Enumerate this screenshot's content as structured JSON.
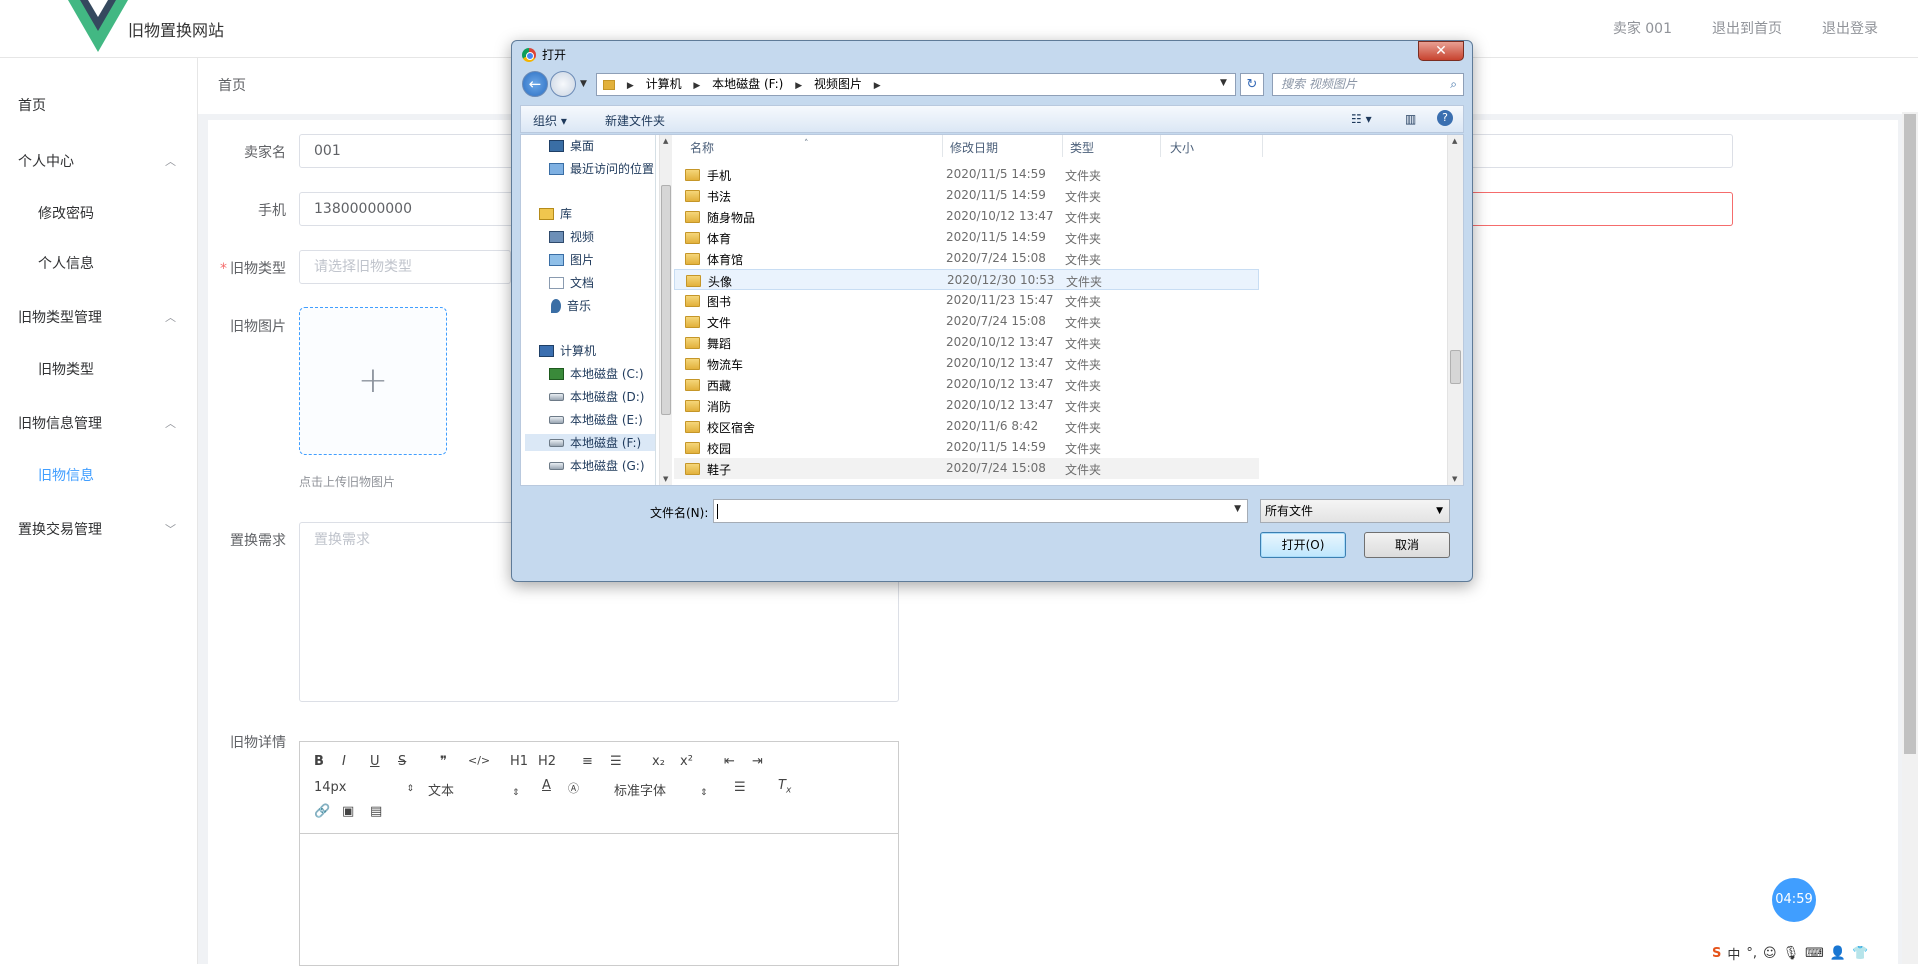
{
  "site": {
    "title": "旧物置换网站",
    "brand_color": "#42b883"
  },
  "top_links": [
    "卖家 001",
    "退出到首页",
    "退出登录"
  ],
  "sidebar": {
    "items": [
      {
        "label": "首页",
        "level": 1,
        "arrow": ""
      },
      {
        "label": "个人中心",
        "level": 1,
        "arrow": "^"
      },
      {
        "label": "修改密码",
        "level": 2,
        "arrow": ""
      },
      {
        "label": "个人信息",
        "level": 2,
        "arrow": ""
      },
      {
        "label": "旧物类型管理",
        "level": 1,
        "arrow": "^"
      },
      {
        "label": "旧物类型",
        "level": 2,
        "arrow": ""
      },
      {
        "label": "旧物信息管理",
        "level": 1,
        "arrow": "^"
      },
      {
        "label": "旧物信息",
        "level": 2,
        "arrow": "",
        "active": true
      },
      {
        "label": "置换交易管理",
        "level": 1,
        "arrow": "v"
      }
    ]
  },
  "breadcrumb": "首页",
  "form": {
    "seller_name_label": "卖家名",
    "seller_name_value": "001",
    "phone_label": "手机",
    "phone_value": "13800000000",
    "type_label": "旧物类型",
    "type_placeholder": "请选择旧物类型",
    "image_label": "旧物图片",
    "upload_plus": "+",
    "upload_tip": "点击上传旧物图片",
    "demand_label": "置换需求",
    "demand_placeholder": "置换需求",
    "detail_label": "旧物详情"
  },
  "editor": {
    "font_size": "14px",
    "text_style": "文本",
    "font_family": "标准字体",
    "buttons": [
      "B",
      "I",
      "U",
      "S",
      "❞",
      "</>",
      "H1",
      "H2",
      "≡",
      "☰",
      "x₂",
      "x²",
      "⇤",
      "⇥"
    ]
  },
  "timer": "04:59",
  "dialog": {
    "title": "打开",
    "close": "✕",
    "path": [
      "计算机",
      "本地磁盘 (F:)",
      "视频图片"
    ],
    "search_placeholder": "搜索 视频图片",
    "cmd_organize": "组织 ▾",
    "cmd_new_folder": "新建文件夹",
    "nav_pane": [
      {
        "label": "桌面",
        "icon": "desktop-icon"
      },
      {
        "label": "最近访问的位置",
        "icon": "recent-icon"
      },
      {
        "label": "库",
        "icon": "library-icon"
      },
      {
        "label": "视频",
        "icon": "video-icon"
      },
      {
        "label": "图片",
        "icon": "picture-icon"
      },
      {
        "label": "文档",
        "icon": "document-icon"
      },
      {
        "label": "音乐",
        "icon": "music-icon"
      },
      {
        "label": "计算机",
        "icon": "computer-icon"
      },
      {
        "label": "本地磁盘 (C:)",
        "icon": "drive-icon"
      },
      {
        "label": "本地磁盘 (D:)",
        "icon": "drive-icon"
      },
      {
        "label": "本地磁盘 (E:)",
        "icon": "drive-icon"
      },
      {
        "label": "本地磁盘 (F:)",
        "icon": "drive-icon",
        "selected": true
      },
      {
        "label": "本地磁盘 (G:)",
        "icon": "drive-icon"
      }
    ],
    "columns": [
      "名称",
      "修改日期",
      "类型",
      "大小"
    ],
    "files": [
      {
        "name": "手机",
        "date": "2020/11/5 14:59",
        "type": "文件夹"
      },
      {
        "name": "书法",
        "date": "2020/11/5 14:59",
        "type": "文件夹"
      },
      {
        "name": "随身物品",
        "date": "2020/10/12 13:47",
        "type": "文件夹"
      },
      {
        "name": "体育",
        "date": "2020/11/5 14:59",
        "type": "文件夹"
      },
      {
        "name": "体育馆",
        "date": "2020/7/24 15:08",
        "type": "文件夹"
      },
      {
        "name": "头像",
        "date": "2020/12/30 10:53",
        "type": "文件夹",
        "hover": true
      },
      {
        "name": "图书",
        "date": "2020/11/23 15:47",
        "type": "文件夹"
      },
      {
        "name": "文件",
        "date": "2020/7/24 15:08",
        "type": "文件夹"
      },
      {
        "name": "舞蹈",
        "date": "2020/10/12 13:47",
        "type": "文件夹"
      },
      {
        "name": "物流车",
        "date": "2020/10/12 13:47",
        "type": "文件夹"
      },
      {
        "name": "西藏",
        "date": "2020/10/12 13:47",
        "type": "文件夹"
      },
      {
        "name": "消防",
        "date": "2020/10/12 13:47",
        "type": "文件夹"
      },
      {
        "name": "校区宿舍",
        "date": "2020/11/6 8:42",
        "type": "文件夹"
      },
      {
        "name": "校园",
        "date": "2020/11/5 14:59",
        "type": "文件夹"
      },
      {
        "name": "鞋子",
        "date": "2020/7/24 15:08",
        "type": "文件夹"
      }
    ],
    "filename_label": "文件名(N):",
    "filename_value": "",
    "filetype": "所有文件",
    "open_button": "打开(O)",
    "cancel_button": "取消"
  },
  "ime": {
    "logo": "S",
    "mode": "中"
  }
}
